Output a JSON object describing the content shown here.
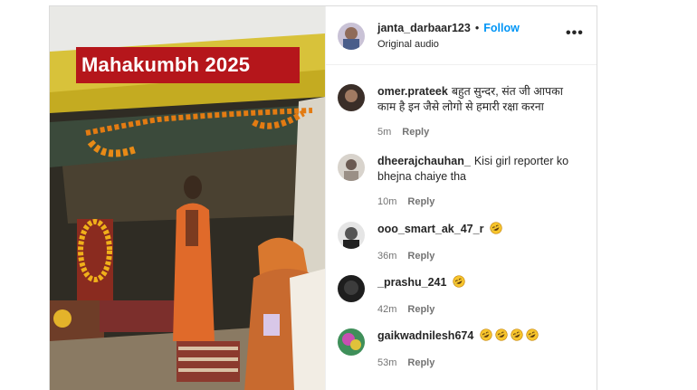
{
  "media": {
    "headline": "Mahakumbh 2025"
  },
  "header": {
    "username": "janta_darbaar123",
    "separator": "•",
    "follow_label": "Follow",
    "audio": "Original audio",
    "more_icon": "more-horizontal-icon"
  },
  "comments": [
    {
      "username": "omer.prateek",
      "text": "बहुत सुन्दर, संत जी आपका काम है इन जैसे लोगो से हमारी रक्षा करना",
      "emoji_count": 0,
      "time": "5m",
      "reply": "Reply"
    },
    {
      "username": "dheerajchauhan_",
      "text": "Kisi girl reporter ko bhejna chaiye tha",
      "emoji_count": 0,
      "time": "10m",
      "reply": "Reply"
    },
    {
      "username": "ooo_smart_ak_47_r",
      "text": "",
      "emoji_count": 1,
      "time": "36m",
      "reply": "Reply"
    },
    {
      "username": "_prashu_241",
      "text": "",
      "emoji_count": 1,
      "time": "42m",
      "reply": "Reply"
    },
    {
      "username": "gaikwadnilesh674",
      "text": "",
      "emoji_count": 4,
      "time": "53m",
      "reply": "Reply"
    }
  ],
  "emoji_icon": "rofl-emoji-icon",
  "colors": {
    "follow": "#0095f6",
    "headline_bg": "#b5161b",
    "meta": "#737373"
  }
}
